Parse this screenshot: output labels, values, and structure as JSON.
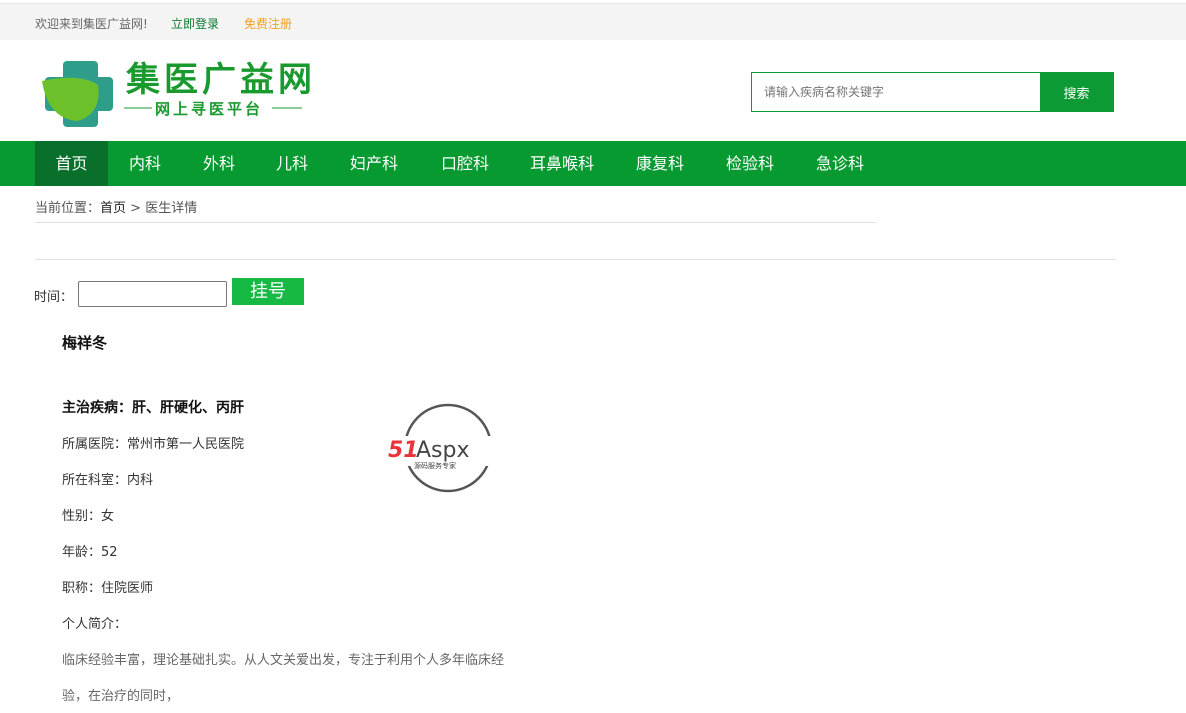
{
  "topbar": {
    "welcome": "欢迎来到集医广益网!",
    "login": "立即登录",
    "register": "免费注册"
  },
  "logo": {
    "title": "集医广益网",
    "slogan": "网上寻医平台"
  },
  "search": {
    "placeholder": "请输入疾病名称关键字",
    "button": "搜索"
  },
  "nav": [
    "首页",
    "内科",
    "外科",
    "儿科",
    "妇产科",
    "口腔科",
    "耳鼻喉科",
    "康复科",
    "检验科",
    "急诊科"
  ],
  "breadcrumb": {
    "prefix": "当前位置：",
    "home": "首页",
    "sep": " > ",
    "current": "医生详情"
  },
  "booking": {
    "time_label": "时间：",
    "time_value": "",
    "button": "挂号"
  },
  "doctor": {
    "name": "梅祥冬",
    "specialty": "主治疾病：肝、肝硬化、丙肝",
    "hospital": "所属医院：常州市第一人民医院",
    "department": "所在科室：内科",
    "gender": "性别：女",
    "age": "年龄：52",
    "title": "职称：住院医师",
    "intro_label": "个人简介：",
    "intro_line1": "临床经验丰富，理论基础扎实。从人文关爱出发，专注于利用个人多年临床经",
    "intro_line2": "验，在治疗的同时，"
  },
  "watermark": {
    "brand": "51Aspx",
    "sub": "源码服务专家"
  },
  "colors": {
    "green": "#079a31",
    "active": "#08702a",
    "button": "#15b943",
    "register": "#f0a020"
  }
}
